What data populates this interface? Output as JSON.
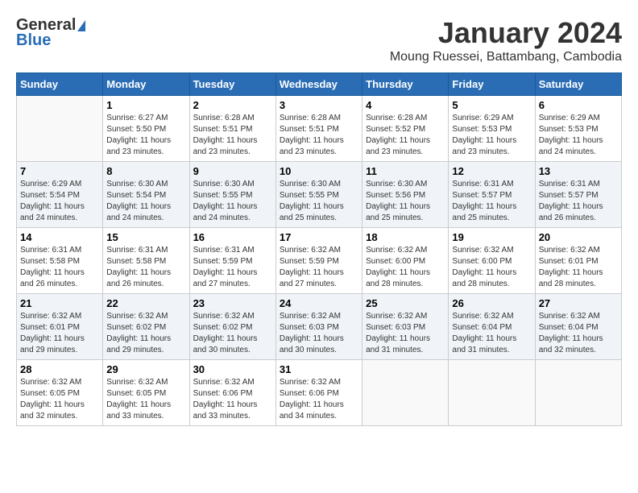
{
  "logo": {
    "general": "General",
    "blue": "Blue"
  },
  "title": "January 2024",
  "location": "Moung Ruessei, Battambang, Cambodia",
  "headers": [
    "Sunday",
    "Monday",
    "Tuesday",
    "Wednesday",
    "Thursday",
    "Friday",
    "Saturday"
  ],
  "weeks": [
    [
      {
        "day": "",
        "info": ""
      },
      {
        "day": "1",
        "info": "Sunrise: 6:27 AM\nSunset: 5:50 PM\nDaylight: 11 hours\nand 23 minutes."
      },
      {
        "day": "2",
        "info": "Sunrise: 6:28 AM\nSunset: 5:51 PM\nDaylight: 11 hours\nand 23 minutes."
      },
      {
        "day": "3",
        "info": "Sunrise: 6:28 AM\nSunset: 5:51 PM\nDaylight: 11 hours\nand 23 minutes."
      },
      {
        "day": "4",
        "info": "Sunrise: 6:28 AM\nSunset: 5:52 PM\nDaylight: 11 hours\nand 23 minutes."
      },
      {
        "day": "5",
        "info": "Sunrise: 6:29 AM\nSunset: 5:53 PM\nDaylight: 11 hours\nand 23 minutes."
      },
      {
        "day": "6",
        "info": "Sunrise: 6:29 AM\nSunset: 5:53 PM\nDaylight: 11 hours\nand 24 minutes."
      }
    ],
    [
      {
        "day": "7",
        "info": "Sunrise: 6:29 AM\nSunset: 5:54 PM\nDaylight: 11 hours\nand 24 minutes."
      },
      {
        "day": "8",
        "info": "Sunrise: 6:30 AM\nSunset: 5:54 PM\nDaylight: 11 hours\nand 24 minutes."
      },
      {
        "day": "9",
        "info": "Sunrise: 6:30 AM\nSunset: 5:55 PM\nDaylight: 11 hours\nand 24 minutes."
      },
      {
        "day": "10",
        "info": "Sunrise: 6:30 AM\nSunset: 5:55 PM\nDaylight: 11 hours\nand 25 minutes."
      },
      {
        "day": "11",
        "info": "Sunrise: 6:30 AM\nSunset: 5:56 PM\nDaylight: 11 hours\nand 25 minutes."
      },
      {
        "day": "12",
        "info": "Sunrise: 6:31 AM\nSunset: 5:57 PM\nDaylight: 11 hours\nand 25 minutes."
      },
      {
        "day": "13",
        "info": "Sunrise: 6:31 AM\nSunset: 5:57 PM\nDaylight: 11 hours\nand 26 minutes."
      }
    ],
    [
      {
        "day": "14",
        "info": "Sunrise: 6:31 AM\nSunset: 5:58 PM\nDaylight: 11 hours\nand 26 minutes."
      },
      {
        "day": "15",
        "info": "Sunrise: 6:31 AM\nSunset: 5:58 PM\nDaylight: 11 hours\nand 26 minutes."
      },
      {
        "day": "16",
        "info": "Sunrise: 6:31 AM\nSunset: 5:59 PM\nDaylight: 11 hours\nand 27 minutes."
      },
      {
        "day": "17",
        "info": "Sunrise: 6:32 AM\nSunset: 5:59 PM\nDaylight: 11 hours\nand 27 minutes."
      },
      {
        "day": "18",
        "info": "Sunrise: 6:32 AM\nSunset: 6:00 PM\nDaylight: 11 hours\nand 28 minutes."
      },
      {
        "day": "19",
        "info": "Sunrise: 6:32 AM\nSunset: 6:00 PM\nDaylight: 11 hours\nand 28 minutes."
      },
      {
        "day": "20",
        "info": "Sunrise: 6:32 AM\nSunset: 6:01 PM\nDaylight: 11 hours\nand 28 minutes."
      }
    ],
    [
      {
        "day": "21",
        "info": "Sunrise: 6:32 AM\nSunset: 6:01 PM\nDaylight: 11 hours\nand 29 minutes."
      },
      {
        "day": "22",
        "info": "Sunrise: 6:32 AM\nSunset: 6:02 PM\nDaylight: 11 hours\nand 29 minutes."
      },
      {
        "day": "23",
        "info": "Sunrise: 6:32 AM\nSunset: 6:02 PM\nDaylight: 11 hours\nand 30 minutes."
      },
      {
        "day": "24",
        "info": "Sunrise: 6:32 AM\nSunset: 6:03 PM\nDaylight: 11 hours\nand 30 minutes."
      },
      {
        "day": "25",
        "info": "Sunrise: 6:32 AM\nSunset: 6:03 PM\nDaylight: 11 hours\nand 31 minutes."
      },
      {
        "day": "26",
        "info": "Sunrise: 6:32 AM\nSunset: 6:04 PM\nDaylight: 11 hours\nand 31 minutes."
      },
      {
        "day": "27",
        "info": "Sunrise: 6:32 AM\nSunset: 6:04 PM\nDaylight: 11 hours\nand 32 minutes."
      }
    ],
    [
      {
        "day": "28",
        "info": "Sunrise: 6:32 AM\nSunset: 6:05 PM\nDaylight: 11 hours\nand 32 minutes."
      },
      {
        "day": "29",
        "info": "Sunrise: 6:32 AM\nSunset: 6:05 PM\nDaylight: 11 hours\nand 33 minutes."
      },
      {
        "day": "30",
        "info": "Sunrise: 6:32 AM\nSunset: 6:06 PM\nDaylight: 11 hours\nand 33 minutes."
      },
      {
        "day": "31",
        "info": "Sunrise: 6:32 AM\nSunset: 6:06 PM\nDaylight: 11 hours\nand 34 minutes."
      },
      {
        "day": "",
        "info": ""
      },
      {
        "day": "",
        "info": ""
      },
      {
        "day": "",
        "info": ""
      }
    ]
  ]
}
